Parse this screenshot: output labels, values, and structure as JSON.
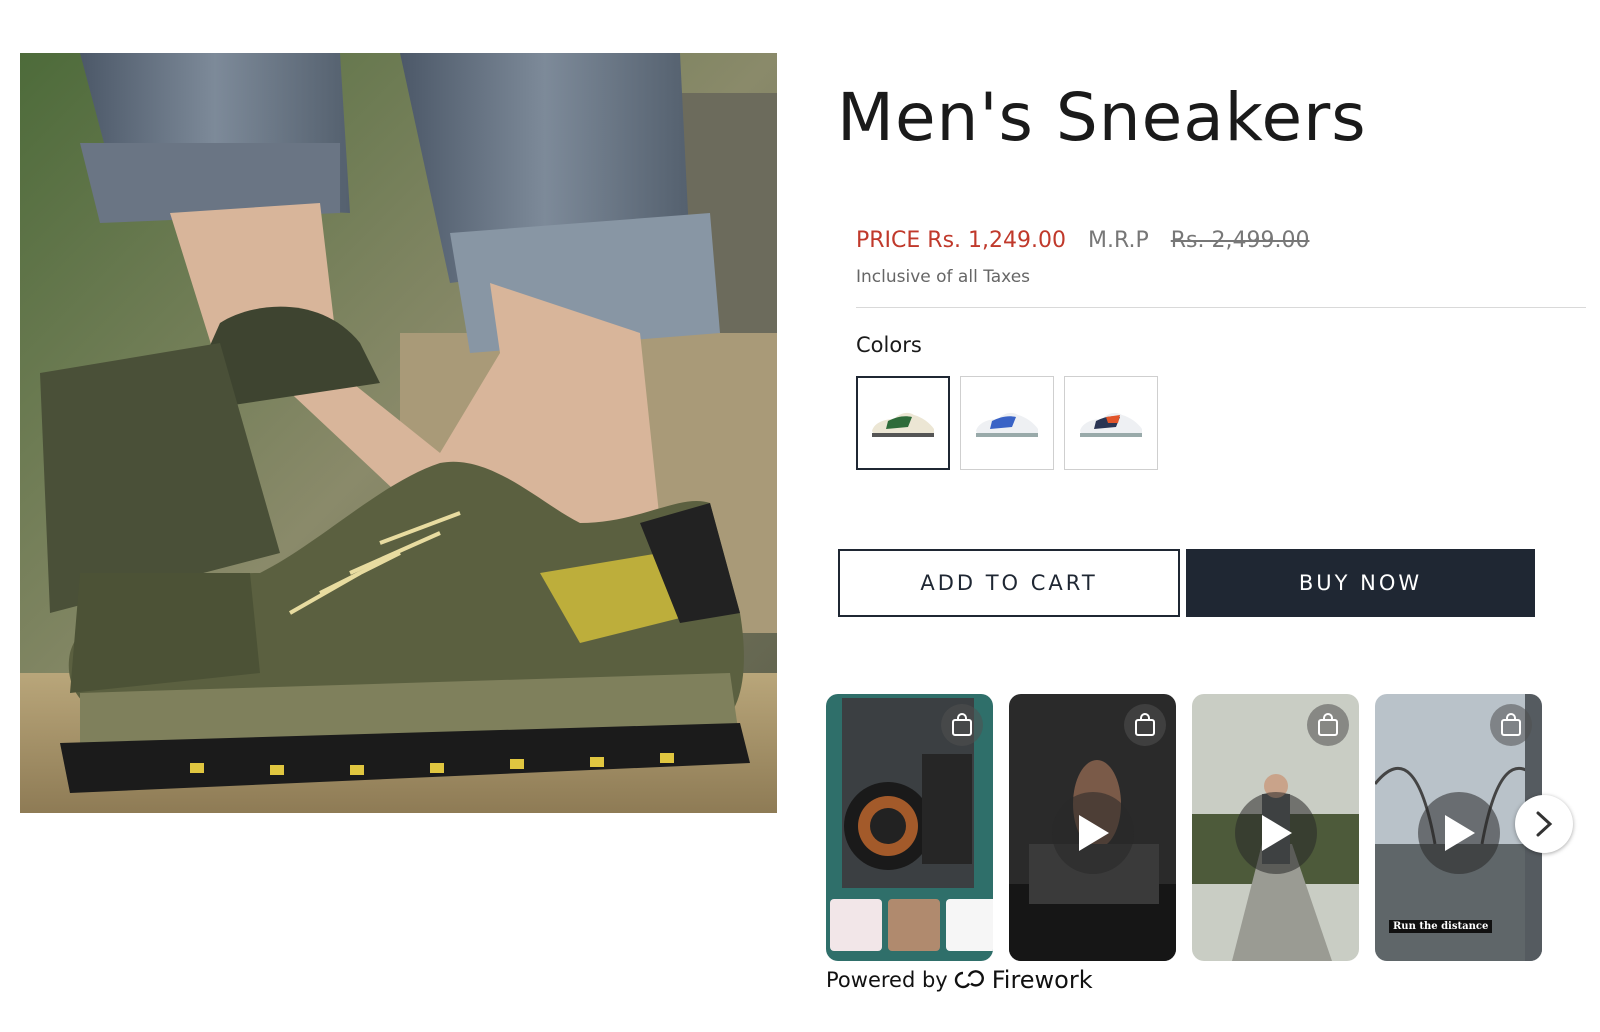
{
  "product": {
    "title": "Men's Sneakers",
    "price_text": "PRICE Rs. 1,249.00",
    "mrp_label": "M.R.P",
    "mrp_value": "Rs. 2,499.00",
    "tax_note": "Inclusive of all Taxes",
    "colors_label": "Colors",
    "color_options": [
      {
        "name": "green-cream",
        "selected": true
      },
      {
        "name": "blue-white",
        "selected": false
      },
      {
        "name": "orange-navy",
        "selected": false
      }
    ]
  },
  "actions": {
    "add_to_cart": "ADD TO CART",
    "buy_now": "BUY NOW"
  },
  "videos": {
    "items": [
      {
        "name": "camera-video"
      },
      {
        "name": "treadmill-video"
      },
      {
        "name": "park-walk-video"
      },
      {
        "name": "bridge-run-video",
        "caption": "Run the distance"
      }
    ],
    "powered_by": "Powered by",
    "brand": "Firework"
  },
  "theme": {
    "accent_red": "#c0392b",
    "dark_navy": "#1f2733"
  }
}
